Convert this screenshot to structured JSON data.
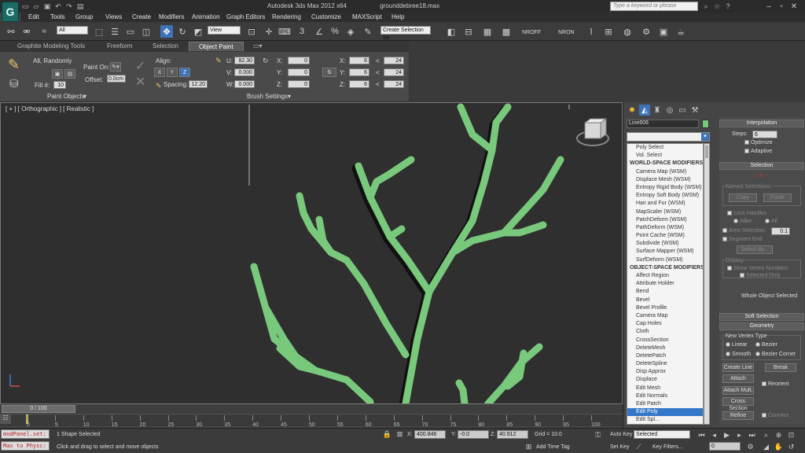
{
  "title": {
    "app": "Autodesk 3ds Max  2012 x64",
    "file": "grounddebree18.max",
    "search_placeholder": "Type a keyword or phrase",
    "logo": "G"
  },
  "menu": [
    "Edit",
    "Tools",
    "Group",
    "Views",
    "Create",
    "Modifiers",
    "Animation",
    "Graph Editors",
    "Rendering",
    "Customize",
    "MAXScript",
    "Help"
  ],
  "toolbar": {
    "selection_filter": "All",
    "ref_coord": "View",
    "named_selection": "Create Selection Se",
    "nroff": "NROFF",
    "nron": "NRON"
  },
  "ribbon": {
    "tabs": [
      "Graphite Modeling Tools",
      "Freeform",
      "Selection",
      "Object Paint"
    ],
    "active_tab": "Object Paint",
    "all_randomly": "All, Randomly",
    "paint_on": "Paint On:",
    "fill_label": "Fill #:",
    "fill_value": "10",
    "offset_label": "Offset:",
    "offset_value": "0.0cm",
    "align_label": "Align:",
    "axes": [
      "X",
      "Y",
      "Z"
    ],
    "spacing_label": "Spacing:",
    "spacing_value": "12.20",
    "u_label": "U:",
    "u_value": "82.30",
    "v_label": "V:",
    "v_value": "0.000",
    "w_label": "W:",
    "w_value": "0.000",
    "rx": {
      "x": "0",
      "y": "0",
      "z": "0"
    },
    "sx": {
      "x": "6",
      "y": "6",
      "z": "6"
    },
    "sm": {
      "x": "24",
      "y": "24",
      "z": "24"
    },
    "paint_objects": "Paint Objects",
    "brush_settings": "Brush Settings"
  },
  "viewport": {
    "label": "[ + ] [ Orthographic ] [ Realistic ]"
  },
  "command_panel": {
    "object_name": "Line606",
    "modifiers": [
      {
        "label": "Poly Select",
        "type": "item"
      },
      {
        "label": "Vol. Select",
        "type": "item"
      },
      {
        "label": "WORLD-SPACE MODIFIERS",
        "type": "header"
      },
      {
        "label": "Camera Map (WSM)",
        "type": "item"
      },
      {
        "label": "Displace Mesh (WSM)",
        "type": "item"
      },
      {
        "label": "Entropy Rigid Body (WSM)",
        "type": "item"
      },
      {
        "label": "Entropy Soft Body (WSM)",
        "type": "item"
      },
      {
        "label": "Hair and Fur (WSM)",
        "type": "item"
      },
      {
        "label": "MapScaler (WSM)",
        "type": "item"
      },
      {
        "label": "PatchDeform (WSM)",
        "type": "item"
      },
      {
        "label": "PathDeform (WSM)",
        "type": "item"
      },
      {
        "label": "Point Cache (WSM)",
        "type": "item"
      },
      {
        "label": "Subdivide (WSM)",
        "type": "item"
      },
      {
        "label": "Surface Mapper (WSM)",
        "type": "item"
      },
      {
        "label": "SurfDeform (WSM)",
        "type": "item"
      },
      {
        "label": "OBJECT-SPACE MODIFIERS",
        "type": "header"
      },
      {
        "label": "Affect Region",
        "type": "item"
      },
      {
        "label": "Attribute Holder",
        "type": "item"
      },
      {
        "label": "Bend",
        "type": "item"
      },
      {
        "label": "Bevel",
        "type": "item"
      },
      {
        "label": "Bevel Profile",
        "type": "item"
      },
      {
        "label": "Camera Map",
        "type": "item"
      },
      {
        "label": "Cap Holes",
        "type": "item"
      },
      {
        "label": "Cloth",
        "type": "item"
      },
      {
        "label": "CrossSection",
        "type": "item"
      },
      {
        "label": "DeleteMesh",
        "type": "item"
      },
      {
        "label": "DeletePatch",
        "type": "item"
      },
      {
        "label": "DeleteSpline",
        "type": "item"
      },
      {
        "label": "Disp Approx",
        "type": "item"
      },
      {
        "label": "Displace",
        "type": "item"
      },
      {
        "label": "Edit Mesh",
        "type": "item"
      },
      {
        "label": "Edit Normals",
        "type": "item"
      },
      {
        "label": "Edit Patch",
        "type": "item"
      },
      {
        "label": "Edit Poly",
        "type": "selected"
      },
      {
        "label": "Edit Spl...",
        "type": "item"
      }
    ],
    "rollout": {
      "interpolation": "Interpolation",
      "steps_label": "Steps:",
      "steps_value": "6",
      "optimize": "Optimize",
      "adaptive": "Adaptive",
      "selection": "Selection",
      "named_selections": "Named Selections:",
      "copy": "Copy",
      "paste": "Paste",
      "lock_handles": "Lock Handles",
      "alike": "Alike",
      "all": "All",
      "area_selection": "Area Selection:",
      "area_value": "0.1",
      "segment_end": "Segment End",
      "select_by": "Select By...",
      "display": "Display",
      "show_vertex_numbers": "Show Vertex Numbers",
      "selected_only": "Selected Only",
      "whole_object_selected": "Whole Object Selected",
      "soft_selection": "Soft Selection",
      "geometry": "Geometry",
      "new_vertex_type": "New Vertex Type",
      "linear": "Linear",
      "bezier": "Bezier",
      "smooth": "Smooth",
      "bezier_corner": "Bezier Corner",
      "create_line": "Create Line",
      "break": "Break",
      "attach": "Attach",
      "reorient": "Reorient",
      "attach_mult": "Attach Mult.",
      "cross_section": "Cross Section",
      "refine": "Refine",
      "connect": "Connect"
    }
  },
  "timeline": {
    "frame": "0 / 100",
    "ticks": [
      "0",
      "5",
      "10",
      "15",
      "20",
      "25",
      "30",
      "35",
      "40",
      "45",
      "50",
      "55",
      "60",
      "65",
      "70",
      "75",
      "80",
      "85",
      "90",
      "95",
      "100"
    ]
  },
  "status": {
    "maxscript1": "modPanel.set:",
    "maxscript2": "Max to Physc:",
    "shapes_selected": "1 Shape Selected",
    "prompt": "Click and drag to select and move objects",
    "x_label": "X:",
    "x_value": "400.846",
    "y_label": "Y:",
    "y_value": "-0.0",
    "z_label": "Z:",
    "z_value": "40.912",
    "grid": "Grid = 10.0",
    "add_time_tag": "Add Time Tag",
    "auto_key": "Auto Key",
    "selected": "Selected",
    "set_key": "Set Key",
    "key_filters": "Key Filters...",
    "frame_field": "0"
  },
  "colors": {
    "branch": "#79c97d",
    "viewport_bg": "#2f2f2f",
    "selection_blue": "#3377c8"
  }
}
